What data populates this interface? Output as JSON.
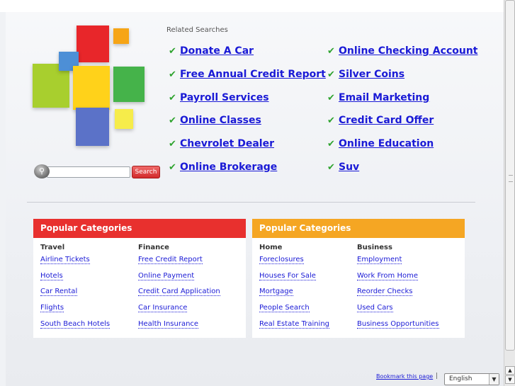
{
  "search": {
    "placeholder": "",
    "button_label": "Search"
  },
  "related": {
    "title": "Related Searches",
    "left": [
      "Donate A Car",
      "Free Annual Credit Report",
      "Payroll Services",
      "Online Classes",
      "Chevrolet Dealer",
      "Online Brokerage"
    ],
    "right": [
      "Online Checking Account",
      "Silver Coins",
      "Email Marketing",
      "Credit Card Offer",
      "Online Education",
      "Suv"
    ]
  },
  "panels": [
    {
      "title": "Popular Categories",
      "color": "#e8302e",
      "columns": [
        {
          "title": "Travel",
          "links": [
            "Airline Tickets",
            "Hotels",
            "Car Rental",
            "Flights",
            "South Beach Hotels"
          ]
        },
        {
          "title": "Finance",
          "links": [
            "Free Credit Report",
            "Online Payment",
            "Credit Card Application",
            "Car Insurance",
            "Health Insurance"
          ]
        }
      ]
    },
    {
      "title": "Popular Categories",
      "color": "#f5a623",
      "columns": [
        {
          "title": "Home",
          "links": [
            "Foreclosures",
            "Houses For Sale",
            "Mortgage",
            "People Search",
            "Real Estate Training"
          ]
        },
        {
          "title": "Business",
          "links": [
            "Employment",
            "Work From Home",
            "Reorder Checks",
            "Used Cars",
            "Business Opportunities"
          ]
        }
      ]
    }
  ],
  "footer": {
    "bookmark": "Bookmark this page",
    "separator": "|",
    "language": "English"
  },
  "colors": {
    "link": "#1a1ad6",
    "check": "#2ea32e",
    "search_button": "#d22a2a"
  }
}
